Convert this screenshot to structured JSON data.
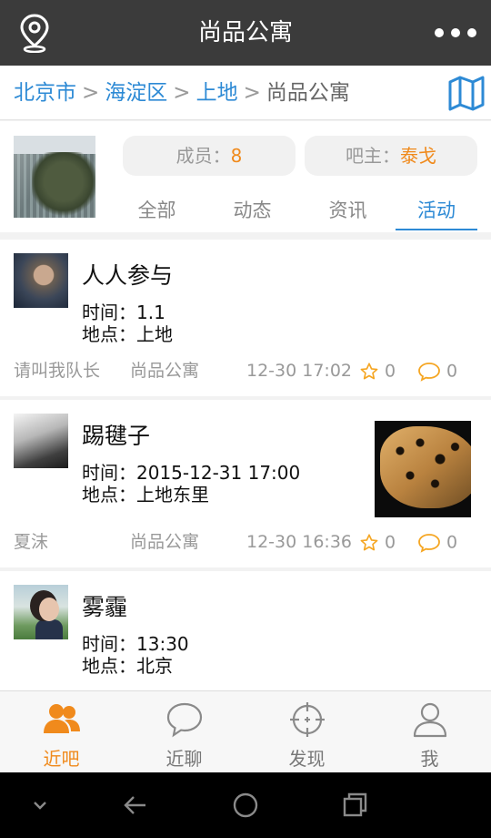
{
  "topbar": {
    "title": "尚品公寓",
    "location_icon": "location-pin-icon",
    "more_icon": "more-dots-icon"
  },
  "breadcrumb": {
    "items": [
      "北京市",
      "海淀区",
      "上地"
    ],
    "current": "尚品公寓",
    "separator": ">",
    "map_icon": "map-icon"
  },
  "group": {
    "members_label": "成员：",
    "members_value": "8",
    "owner_label": "吧主：",
    "owner_value": "泰戈"
  },
  "tabs": [
    {
      "label": "全部",
      "active": false
    },
    {
      "label": "动态",
      "active": false
    },
    {
      "label": "资讯",
      "active": false
    },
    {
      "label": "活动",
      "active": true
    }
  ],
  "posts": [
    {
      "title": "人人参与",
      "time_label": "时间：",
      "time_value": "1.1",
      "place_label": "地点：",
      "place_value": "上地",
      "author": "请叫我队长",
      "group": "尚品公寓",
      "timestamp": "12-30 17:02",
      "likes": "0",
      "comments": "0"
    },
    {
      "title": "踢毽子",
      "time_label": "时间：",
      "time_value": "2015-12-31 17:00",
      "place_label": "地点：",
      "place_value": "上地东里",
      "author": "夏沫",
      "group": "尚品公寓",
      "timestamp": "12-30 16:36",
      "likes": "0",
      "comments": "0"
    },
    {
      "title": "雾霾",
      "time_label": "时间：",
      "time_value": "13:30",
      "place_label": "地点：",
      "place_value": "北京"
    }
  ],
  "bottom_nav": [
    {
      "label": "近吧",
      "icon": "people-icon",
      "active": true
    },
    {
      "label": "近聊",
      "icon": "chat-bubble-icon",
      "active": false
    },
    {
      "label": "发现",
      "icon": "crosshair-icon",
      "active": false
    },
    {
      "label": "我",
      "icon": "user-icon",
      "active": false
    }
  ],
  "colors": {
    "accent_blue": "#2d8ad5",
    "accent_orange": "#f08a1c",
    "topbar": "#3b3b3b"
  }
}
